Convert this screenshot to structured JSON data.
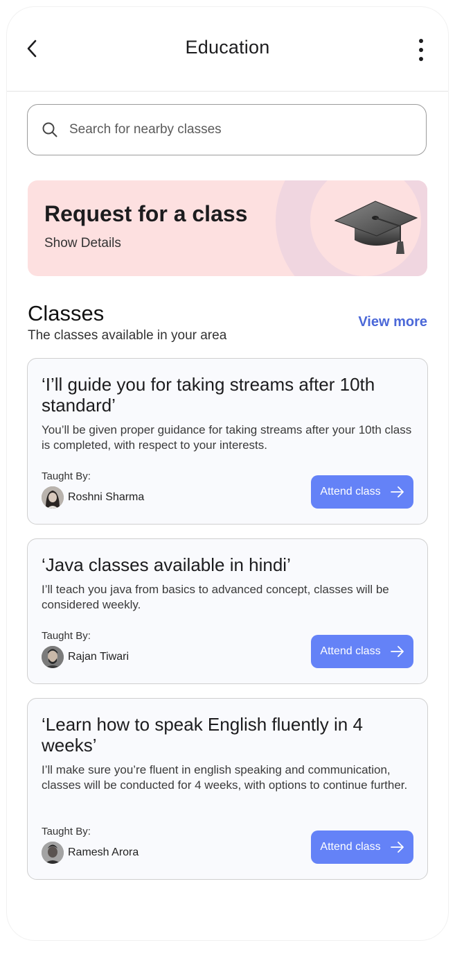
{
  "header": {
    "title": "Education",
    "back_icon": "chevron-left-icon",
    "menu_icon": "more-vertical-icon"
  },
  "search": {
    "placeholder": "Search for nearby classes",
    "value": "",
    "icon": "search-icon"
  },
  "banner": {
    "title": "Request for a class",
    "subtitle": "Show Details",
    "image": "graduation-cap-icon",
    "background_color": "#fde0e0"
  },
  "classes_section": {
    "title": "Classes",
    "subtitle": "The classes available in your area",
    "view_more_label": "View more",
    "accent_color": "#4b68d8"
  },
  "classes": [
    {
      "title": "‘I’ll guide you for taking streams after 10th standard’",
      "description": "You’ll be given proper guidance for taking streams after your 10th class is completed, with respect to your interests.",
      "taught_by_label": "Taught By:",
      "teacher": "Roshni Sharma",
      "button_label": "Attend class"
    },
    {
      "title": "‘Java classes available in hindi’",
      "description": "I’ll teach you java from basics to advanced concept, classes will be considered weekly.",
      "taught_by_label": "Taught By:",
      "teacher": "Rajan Tiwari",
      "button_label": "Attend class"
    },
    {
      "title": "‘Learn how to speak English fluently in 4 weeks’",
      "description": "I’ll make sure you’re fluent in english speaking and communication, classes will be conducted for 4 weeks, with options to continue further.",
      "taught_by_label": "Taught By:",
      "teacher": "Ramesh Arora",
      "button_label": "Attend class"
    }
  ],
  "button_color": "#6482f7"
}
